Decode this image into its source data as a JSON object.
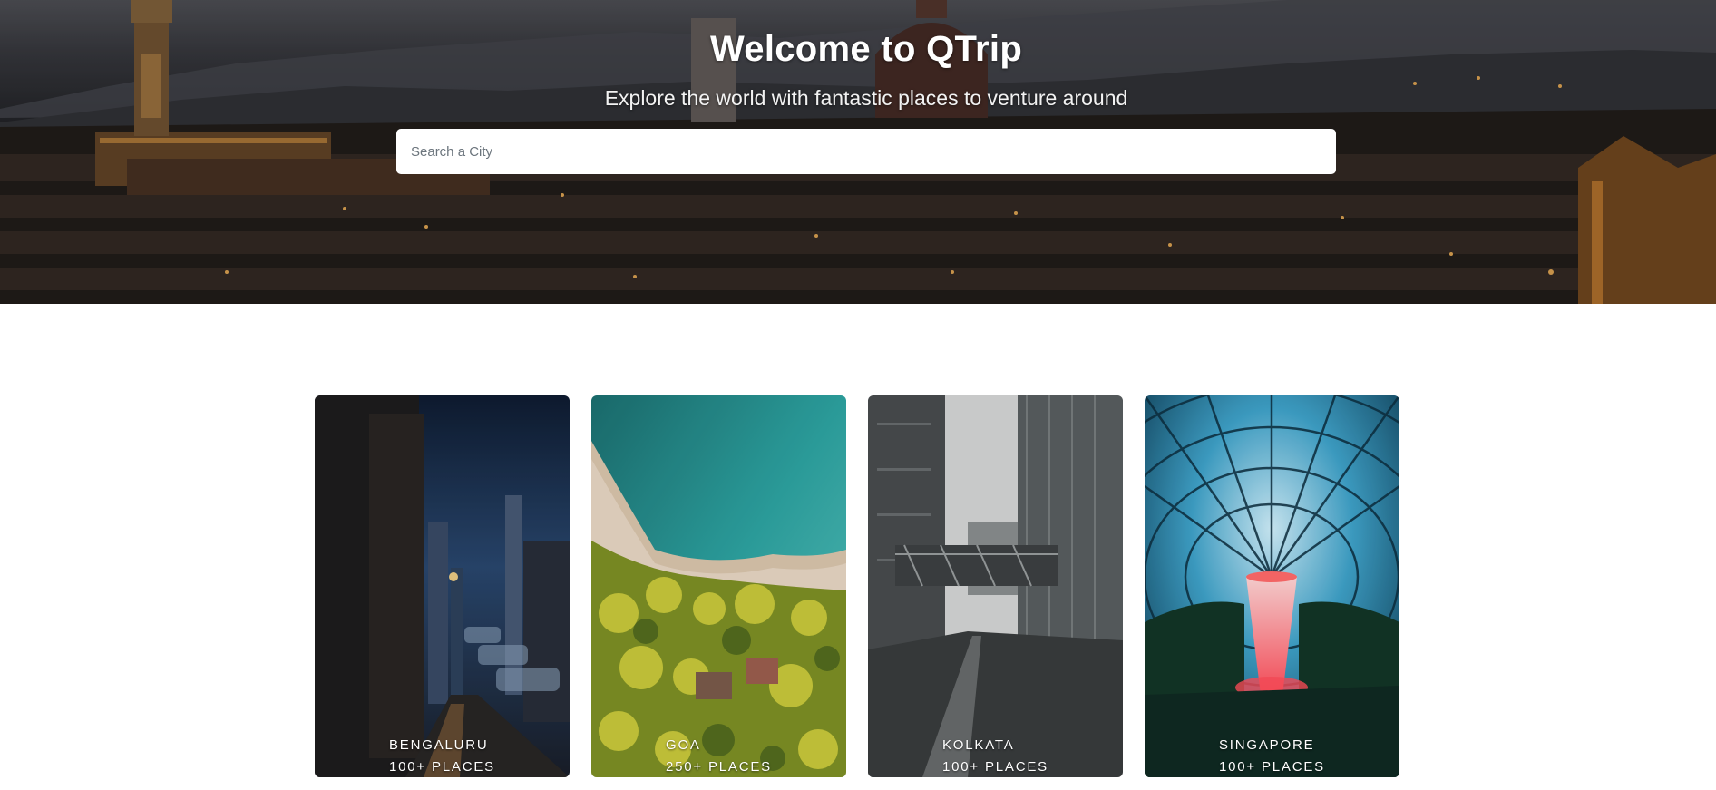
{
  "hero": {
    "title": "Welcome to QTrip",
    "subtitle": "Explore the world with fantastic places to venture around",
    "search_placeholder": "Search a City",
    "search_value": ""
  },
  "cities": [
    {
      "name": "BENGALURU",
      "places": "100+ PLACES"
    },
    {
      "name": "GOA",
      "places": "250+ PLACES"
    },
    {
      "name": "KOLKATA",
      "places": "100+ PLACES"
    },
    {
      "name": "SINGAPORE",
      "places": "100+ PLACES"
    }
  ],
  "colors": {
    "hero_overlay": "#2b2a2c",
    "card_text": "#ffffff",
    "page_background": "#ffffff"
  }
}
